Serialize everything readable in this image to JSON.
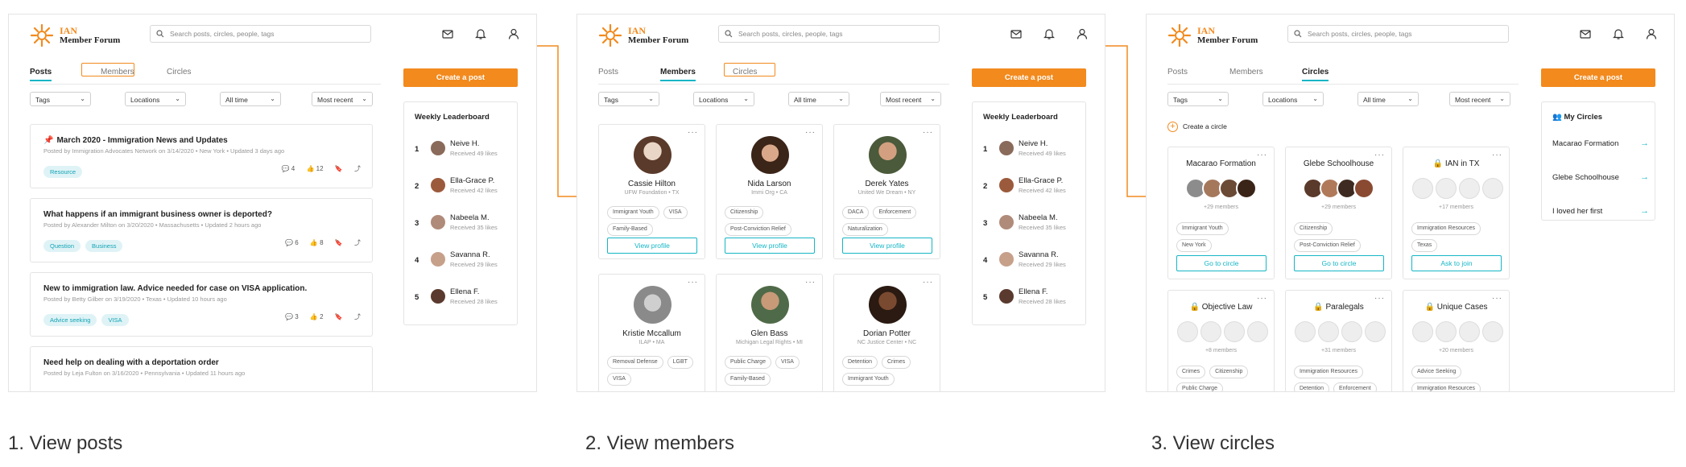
{
  "header": {
    "logo_line1": "IAN",
    "logo_line2": "Member Forum",
    "search_placeholder": "Search posts, circles, people, tags"
  },
  "tabs": [
    "Posts",
    "Members",
    "Circles"
  ],
  "filters": [
    "Tags",
    "Locations",
    "All time",
    "Most recent"
  ],
  "create_post_label": "Create a post",
  "leaderboard": {
    "title": "Weekly Leaderboard",
    "entries": [
      {
        "rank": "1",
        "name": "Neive H.",
        "sub": "Received 49 likes"
      },
      {
        "rank": "2",
        "name": "Ella-Grace P.",
        "sub": "Received 42 likes"
      },
      {
        "rank": "3",
        "name": "Nabeela M.",
        "sub": "Received 35 likes"
      },
      {
        "rank": "4",
        "name": "Savanna R.",
        "sub": "Received 29 likes"
      },
      {
        "rank": "5",
        "name": "Ellena F.",
        "sub": "Received 28 likes"
      }
    ]
  },
  "posts": [
    {
      "title": "March 2020 - Immigration News and Updates",
      "meta": "Posted by Immigration Advocates Network on 3/14/2020 • New York • Updated 3 days ago",
      "tags": [
        "Resource"
      ],
      "comments": "4",
      "likes": "12",
      "pinned": true
    },
    {
      "title": "What happens if an immigrant business owner is deported?",
      "meta": "Posted by Alexander Milton on 3/20/2020 • Massachusetts • Updated 2 hours ago",
      "tags": [
        "Question",
        "Business"
      ],
      "comments": "6",
      "likes": "8",
      "pinned": false
    },
    {
      "title": "New to immigration law. Advice needed for case on VISA application.",
      "meta": "Posted by Betty Gilber on 3/19/2020 • Texas • Updated 10 hours ago",
      "tags": [
        "Advice seeking",
        "VISA"
      ],
      "comments": "3",
      "likes": "2",
      "pinned": false
    },
    {
      "title": "Need help on dealing with a deportation order",
      "meta": "Posted by Leja Fulton on 3/16/2020 • Pennsylvania • Updated 11 hours ago",
      "tags": [],
      "comments": "",
      "likes": "",
      "pinned": false
    }
  ],
  "members": [
    {
      "name": "Cassie Hilton",
      "org": "UFW Foundation • TX",
      "tags": [
        "Immigrant Youth",
        "VISA",
        "Family-Based"
      ],
      "button": "View profile"
    },
    {
      "name": "Nida Larson",
      "org": "Immi Org • CA",
      "tags": [
        "Citizenship",
        "Post-Conviction Relief"
      ],
      "button": "View profile"
    },
    {
      "name": "Derek Yates",
      "org": "United We Dream • NY",
      "tags": [
        "DACA",
        "Enforcement",
        "Naturalization"
      ],
      "button": "View profile"
    },
    {
      "name": "Kristie Mccallum",
      "org": "ILAP • MA",
      "tags": [
        "Removal Defense",
        "LGBT",
        "VISA"
      ],
      "button": ""
    },
    {
      "name": "Glen Bass",
      "org": "Michigan Legal Rights • MI",
      "tags": [
        "Public Charge",
        "VISA",
        "Family-Based"
      ],
      "button": ""
    },
    {
      "name": "Dorian Potter",
      "org": "NC Justice Center • NC",
      "tags": [
        "Detention",
        "Crimes",
        "Immigrant Youth"
      ],
      "button": ""
    }
  ],
  "create_circle_label": "Create a circle",
  "circles": [
    {
      "name": "Macarao Formation",
      "locked": false,
      "count": "+29 members",
      "tags": [
        "Immigrant Youth",
        "New York"
      ],
      "button": "Go to circle"
    },
    {
      "name": "Glebe Schoolhouse",
      "locked": false,
      "count": "+29 members",
      "tags": [
        "Citizenship",
        "Post-Conviction Relief"
      ],
      "button": "Go to circle"
    },
    {
      "name": "IAN in TX",
      "locked": true,
      "count": "+17 members",
      "tags": [
        "Immigration Resources",
        "Texas"
      ],
      "button": "Ask to join"
    },
    {
      "name": "Objective Law",
      "locked": true,
      "count": "+8 members",
      "tags": [
        "Crimes",
        "Citizenship",
        "Public Charge"
      ],
      "button": ""
    },
    {
      "name": "Paralegals",
      "locked": true,
      "count": "+31 members",
      "tags": [
        "Immigration Resources",
        "Detention",
        "Enforcement"
      ],
      "button": ""
    },
    {
      "name": "Unique Cases",
      "locked": true,
      "count": "+20 members",
      "tags": [
        "Advice Seeking",
        "Immigration Resources"
      ],
      "button": ""
    }
  ],
  "my_circles": {
    "title": "My Circles",
    "items": [
      "Macarao Formation",
      "Glebe Schoolhouse",
      "I loved her first"
    ]
  },
  "captions": [
    "1. View posts",
    "2. View members",
    "3. View circles"
  ],
  "colors": {
    "accent_orange": "#f28a1e",
    "accent_teal": "#15b6c6"
  }
}
